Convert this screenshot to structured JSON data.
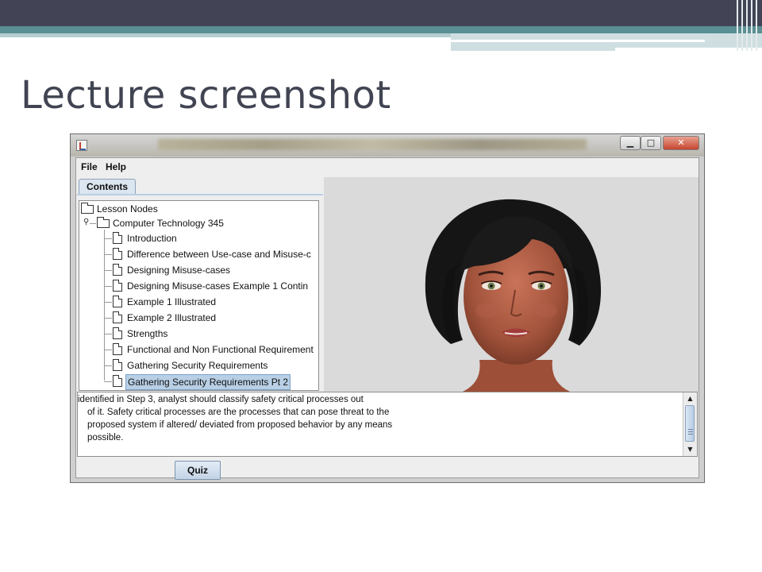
{
  "slide": {
    "title": "Lecture screenshot"
  },
  "window": {
    "menu": [
      "File",
      "Help"
    ],
    "tab_label": "Contents",
    "tree": {
      "root": "Lesson Nodes",
      "course": "Computer Technology 345",
      "lessons": [
        "Introduction",
        "Difference between Use-case and Misuse-c",
        "Designing Misuse-cases",
        "Designing Misuse-cases Example 1 Contin",
        "Example 1 Illustrated",
        "Example 2 Illustrated",
        "Strengths",
        "Functional and Non Functional Requirement",
        "Gathering Security Requirements",
        "Gathering Security Requirements Pt 2"
      ],
      "selected": "Gathering Security Requirements Pt 2"
    },
    "lecture_text": [
      "identified in Step 3, analyst should classify safety critical processes out",
      "of it. Safety critical processes are the processes that can pose threat to the",
      "proposed system if altered/ deviated from proposed behavior by any means",
      "possible."
    ],
    "quiz_label": "Quiz",
    "controls": {
      "minimize_icon": "minimize-icon",
      "maximize_icon": "maximize-icon",
      "close_icon": "close-icon"
    }
  },
  "colors": {
    "header_dark": "#424456",
    "header_teal": "#5a8f93",
    "title_text": "#414452",
    "selection": "#b8cfe5"
  }
}
